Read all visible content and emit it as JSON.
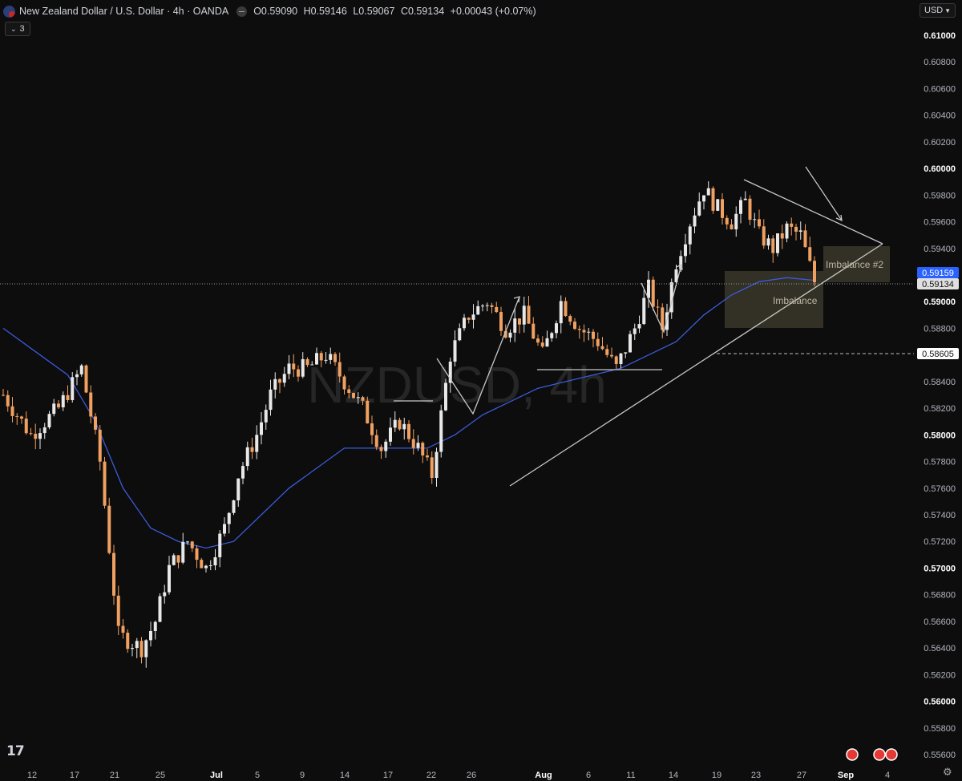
{
  "header": {
    "symbol": "New Zealand Dollar / U.S. Dollar · 4h · OANDA",
    "open": "O0.59090",
    "high": "H0.59146",
    "low": "L0.59067",
    "close": "C0.59134",
    "change": "+0.00043 (+0.07%)",
    "indicator_count": "3",
    "currency": "USD",
    "watermark": "NZDUSD, 4h"
  },
  "colors": {
    "background": "#0d0d0d",
    "up_candle": "#e8e8e8",
    "down_candle": "#f0a060",
    "ma_line": "#3a5bd9",
    "drawing": "#c8c8c8",
    "box_fill": "#3b382c",
    "label_ma": "#2962ff",
    "label_last": "#e0e0e0"
  },
  "labels": {
    "imbalance": "Imbalance",
    "imbalance2": "Imbalance #2",
    "ma_value": "0.59159",
    "last_price": "0.59134",
    "level_value": "0.58605"
  },
  "chart_data": {
    "type": "candlestick",
    "y_ticks": [
      "0.61000",
      "0.60800",
      "0.60600",
      "0.60400",
      "0.60200",
      "0.60000",
      "0.59800",
      "0.59600",
      "0.59400",
      "0.59200",
      "0.59000",
      "0.58800",
      "0.58600",
      "0.58400",
      "0.58200",
      "0.58000",
      "0.57800",
      "0.57600",
      "0.57400",
      "0.57200",
      "0.57000",
      "0.56800",
      "0.56600",
      "0.56400",
      "0.56200",
      "0.56000",
      "0.55800",
      "0.55600"
    ],
    "major_ticks": [
      "0.61000",
      "0.60000",
      "0.59000",
      "0.58000",
      "0.57000",
      "0.56000"
    ],
    "x_ticks": [
      "12",
      "17",
      "21",
      "25",
      "Jul",
      "5",
      "9",
      "14",
      "17",
      "22",
      "26",
      "Aug",
      "6",
      "11",
      "14",
      "19",
      "23",
      "27",
      "Sep",
      "4"
    ],
    "major_x": [
      "Jul",
      "Aug",
      "Sep"
    ],
    "ylim": [
      0.5555,
      0.6105
    ],
    "price_path": [
      [
        0,
        0.583
      ],
      [
        6,
        0.58
      ],
      [
        12,
        0.582
      ],
      [
        17,
        0.585
      ],
      [
        21,
        0.578
      ],
      [
        25,
        0.565
      ],
      [
        30,
        0.564
      ],
      [
        33,
        0.566
      ],
      [
        36,
        0.57
      ],
      [
        40,
        0.572
      ],
      [
        44,
        0.57
      ],
      [
        48,
        0.573
      ],
      [
        51,
        0.577
      ],
      [
        55,
        0.58
      ],
      [
        58,
        0.583
      ],
      [
        62,
        0.585
      ],
      [
        66,
        0.585
      ],
      [
        70,
        0.586
      ],
      [
        74,
        0.584
      ],
      [
        78,
        0.582
      ],
      [
        82,
        0.579
      ],
      [
        86,
        0.581
      ],
      [
        90,
        0.579
      ],
      [
        93,
        0.577
      ],
      [
        97,
        0.586
      ],
      [
        101,
        0.589
      ],
      [
        105,
        0.59
      ],
      [
        109,
        0.588
      ],
      [
        113,
        0.589
      ],
      [
        117,
        0.586
      ],
      [
        121,
        0.59
      ],
      [
        125,
        0.588
      ],
      [
        129,
        0.587
      ],
      [
        133,
        0.585
      ],
      [
        137,
        0.588
      ],
      [
        140,
        0.591
      ],
      [
        143,
        0.588
      ],
      [
        146,
        0.593
      ],
      [
        149,
        0.596
      ],
      [
        152,
        0.5985
      ],
      [
        155,
        0.597
      ],
      [
        158,
        0.596
      ],
      [
        161,
        0.5975
      ],
      [
        164,
        0.595
      ],
      [
        167,
        0.594
      ],
      [
        170,
        0.5955
      ],
      [
        173,
        0.595
      ],
      [
        176,
        0.5915
      ]
    ],
    "ma_path": [
      [
        0,
        0.588
      ],
      [
        8,
        0.586
      ],
      [
        14,
        0.5845
      ],
      [
        20,
        0.581
      ],
      [
        26,
        0.576
      ],
      [
        32,
        0.573
      ],
      [
        38,
        0.572
      ],
      [
        44,
        0.5715
      ],
      [
        50,
        0.572
      ],
      [
        56,
        0.574
      ],
      [
        62,
        0.576
      ],
      [
        68,
        0.5775
      ],
      [
        74,
        0.579
      ],
      [
        80,
        0.579
      ],
      [
        86,
        0.579
      ],
      [
        92,
        0.579
      ],
      [
        98,
        0.58
      ],
      [
        104,
        0.5815
      ],
      [
        110,
        0.5825
      ],
      [
        116,
        0.5835
      ],
      [
        122,
        0.584
      ],
      [
        128,
        0.5845
      ],
      [
        134,
        0.585
      ],
      [
        140,
        0.586
      ],
      [
        146,
        0.587
      ],
      [
        152,
        0.589
      ],
      [
        158,
        0.5905
      ],
      [
        164,
        0.5915
      ],
      [
        170,
        0.5918
      ],
      [
        176,
        0.5916
      ]
    ],
    "series": [
      {
        "name": "price"
      },
      {
        "name": "moving average"
      }
    ]
  }
}
